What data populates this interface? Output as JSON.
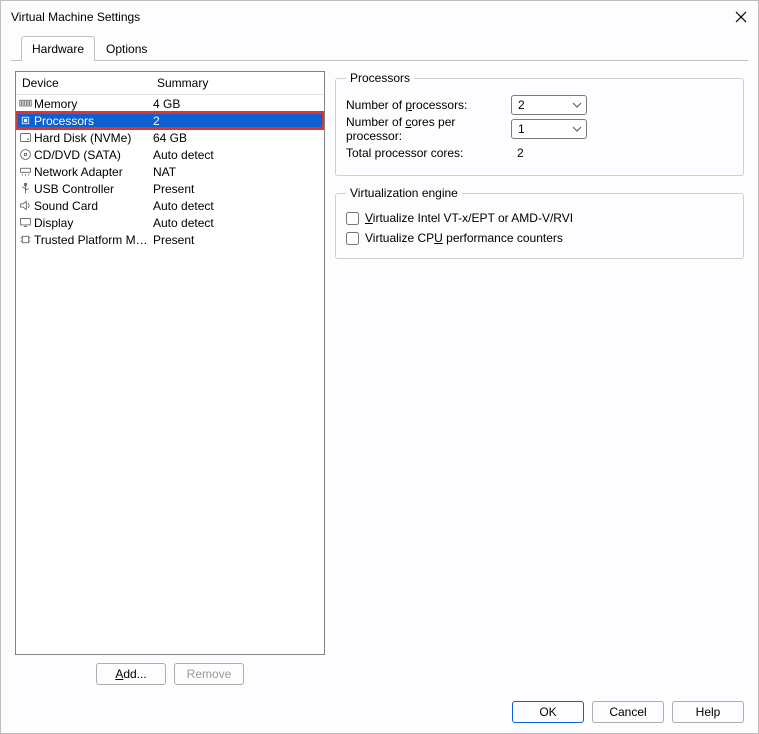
{
  "title": "Virtual Machine Settings",
  "tabs": {
    "hardware": "Hardware",
    "options": "Options"
  },
  "device_list": {
    "col_device": "Device",
    "col_summary": "Summary",
    "items": [
      {
        "name": "Memory",
        "summary": "4 GB"
      },
      {
        "name": "Processors",
        "summary": "2"
      },
      {
        "name": "Hard Disk (NVMe)",
        "summary": "64 GB"
      },
      {
        "name": "CD/DVD (SATA)",
        "summary": "Auto detect"
      },
      {
        "name": "Network Adapter",
        "summary": "NAT"
      },
      {
        "name": "USB Controller",
        "summary": "Present"
      },
      {
        "name": "Sound Card",
        "summary": "Auto detect"
      },
      {
        "name": "Display",
        "summary": "Auto detect"
      },
      {
        "name": "Trusted Platform Mo…",
        "summary": "Present"
      }
    ],
    "add_label": "Add...",
    "remove_label": "Remove"
  },
  "processors_group": {
    "legend": "Processors",
    "num_proc_label": "Number of processors:",
    "num_proc_value": "2",
    "cores_label": "Number of cores per processor:",
    "cores_value": "1",
    "total_label": "Total processor cores:",
    "total_value": "2"
  },
  "virt_group": {
    "legend": "Virtualization engine",
    "vt_label": "Virtualize Intel VT-x/EPT or AMD-V/RVI",
    "perf_label": "Virtualize CPU performance counters"
  },
  "buttons": {
    "ok": "OK",
    "cancel": "Cancel",
    "help": "Help"
  }
}
